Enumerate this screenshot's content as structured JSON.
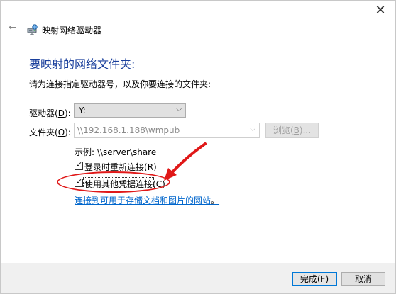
{
  "window": {
    "title": "映射网络驱动器",
    "close_glyph": "✕",
    "back_glyph": "←"
  },
  "heading": "要映射的网络文件夹:",
  "instruction": "请为连接指定驱动器号，以及你要连接的文件夹:",
  "drive": {
    "label_main": "驱动器(",
    "label_key": "D",
    "label_end": "):",
    "value": "Y:"
  },
  "folder": {
    "label_main": "文件夹(",
    "label_key": "O",
    "label_end": "):",
    "value": "\\\\192.168.1.188\\wmpub"
  },
  "browse": {
    "label_main": "浏览(",
    "label_key": "B",
    "label_end": ")..."
  },
  "example": "示例: \\\\server\\share",
  "reconnect": {
    "label_main": "登录时重新连接(",
    "label_key": "R",
    "label_end": ")",
    "checked": true
  },
  "other_credentials": {
    "label_main": "使用其他凭据连接(",
    "label_key": "C",
    "label_end": ")",
    "checked": true
  },
  "link": "连接到可用于存储文档和图片的网站",
  "link_suffix": "。",
  "finish": {
    "label_main": "完成(",
    "label_key": "F",
    "label_end": ")"
  },
  "cancel": "取消",
  "colors": {
    "heading": "#1a3f9c",
    "link": "#0066cc",
    "annotation": "#e01818",
    "focus_border": "#0078d7"
  },
  "icons": {
    "title": "network-drive-icon",
    "back": "back-arrow-icon",
    "dropdown": "chevron-down-icon"
  }
}
